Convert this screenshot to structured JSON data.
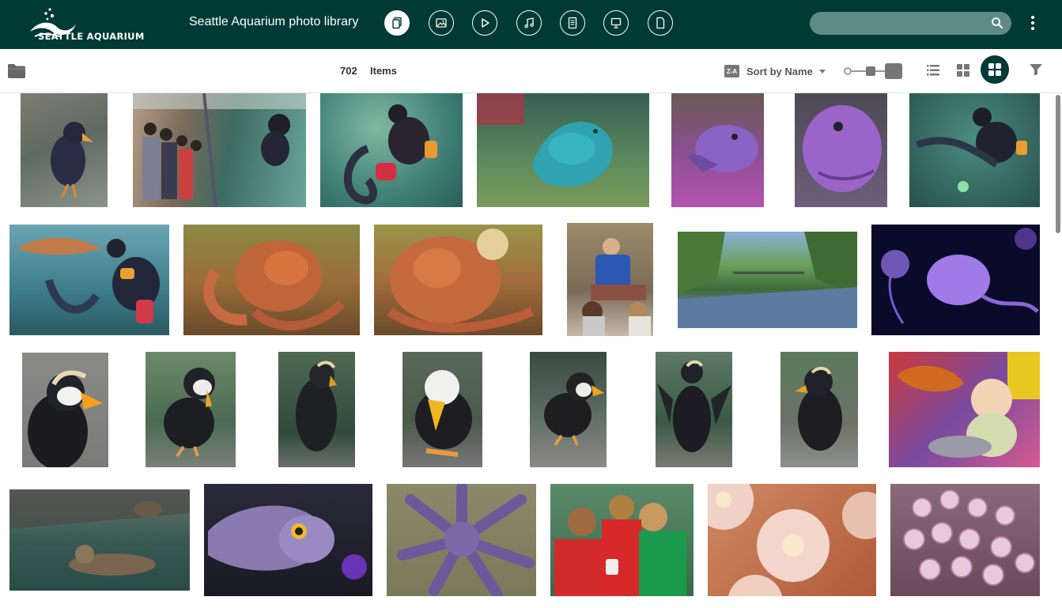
{
  "header": {
    "brand": "SEATTLE AQUARIUM",
    "title": "Seattle Aquarium photo library",
    "type_filters": [
      {
        "name": "all-files",
        "icon": "files-icon",
        "active": true
      },
      {
        "name": "images",
        "icon": "image-icon",
        "active": false
      },
      {
        "name": "videos",
        "icon": "play-icon",
        "active": false
      },
      {
        "name": "audio",
        "icon": "music-note-icon",
        "active": false
      },
      {
        "name": "documents",
        "icon": "document-text-icon",
        "active": false
      },
      {
        "name": "presentations",
        "icon": "presentation-icon",
        "active": false
      },
      {
        "name": "other-files",
        "icon": "blank-file-icon",
        "active": false
      }
    ],
    "search": {
      "placeholder": "",
      "value": ""
    }
  },
  "toolbar": {
    "count": "702",
    "count_label": "Items",
    "sort_badge": "Z-A",
    "sort_label": "Sort by Name",
    "active_view": "mosaic"
  },
  "colors": {
    "header_bg": "#003a35",
    "search_bg": "#5e8c85",
    "accent": "#003a35"
  },
  "thumbnails": [
    {
      "subject": "tufted puffin on rocks"
    },
    {
      "subject": "visitors at aquarium window with diver"
    },
    {
      "subject": "diver with wolf eel"
    },
    {
      "subject": "blue wolf eel on gravel"
    },
    {
      "subject": "purple wolf eel face"
    },
    {
      "subject": "purple wolf eel close-up"
    },
    {
      "subject": "diver feeding wolf eel"
    },
    {
      "subject": "diver with fish and eel"
    },
    {
      "subject": "giant pacific octopus"
    },
    {
      "subject": "giant pacific octopus close"
    },
    {
      "subject": "staff presenting to children"
    },
    {
      "subject": "river with footbridge"
    },
    {
      "subject": "purple jellyfish"
    },
    {
      "subject": "tufted puffin profile"
    },
    {
      "subject": "tufted puffin standing"
    },
    {
      "subject": "tufted puffin back view"
    },
    {
      "subject": "tufted puffin front"
    },
    {
      "subject": "tufted puffin on rock"
    },
    {
      "subject": "tufted puffin wings spread"
    },
    {
      "subject": "tufted puffin side"
    },
    {
      "subject": "baby with plush fish"
    },
    {
      "subject": "sea otters floating"
    },
    {
      "subject": "spotted fish"
    },
    {
      "subject": "sunflower sea star"
    },
    {
      "subject": "children looking at specimen"
    },
    {
      "subject": "anemones close-up"
    },
    {
      "subject": "octopus suckers"
    }
  ]
}
